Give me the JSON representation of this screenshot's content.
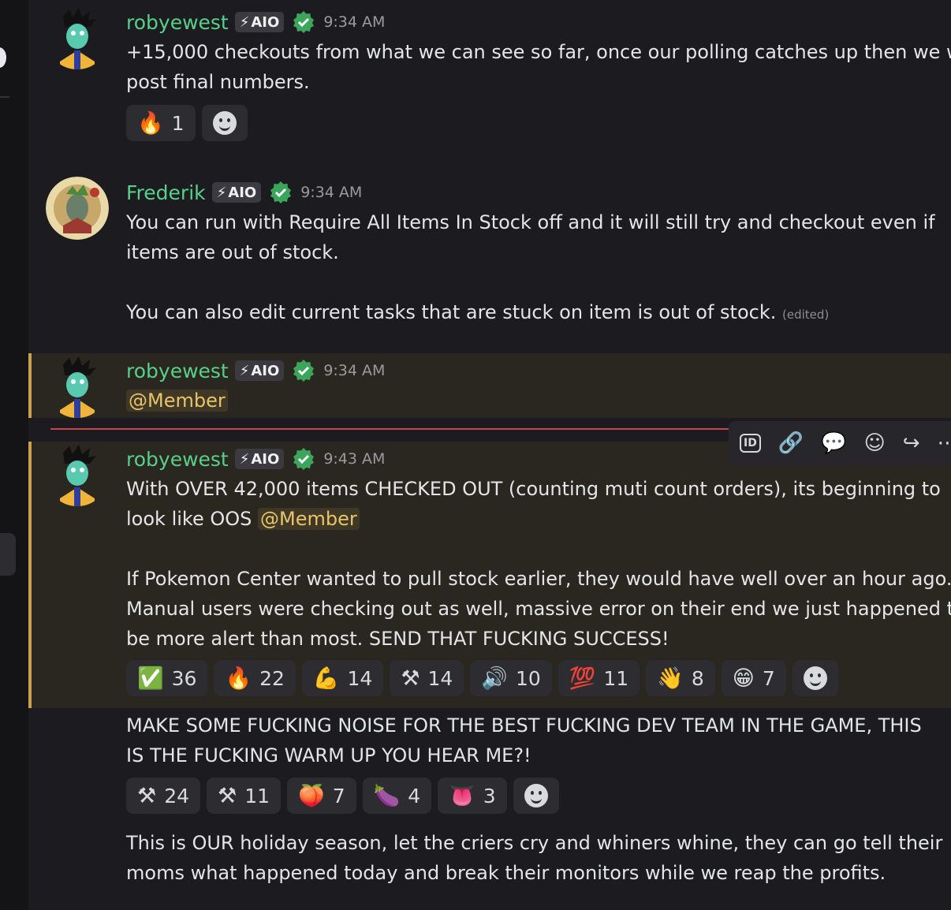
{
  "messages": [
    {
      "username": "robyewest",
      "tag": "AIO",
      "time": "9:34 AM",
      "lines": [
        "+15,000 checkouts from what we can see so far, once our polling catches up then we will",
        "post final numbers."
      ],
      "reactions": [
        {
          "emoji": "🔥",
          "count": "1"
        }
      ]
    },
    {
      "username": "Frederik",
      "tag": "AIO",
      "time": "9:34 AM",
      "lines": [
        "You can run with Require All Items In Stock off and it will still try and checkout even if",
        "items are out of stock.",
        "You can also edit current tasks that are stuck on item is out of stock."
      ],
      "edited": "(edited)"
    },
    {
      "username": "robyewest",
      "tag": "AIO",
      "time": "9:34 AM",
      "mention": "@Member"
    },
    {
      "username": "robyewest",
      "tag": "AIO",
      "time": "9:43 AM",
      "line1": "With OVER 42,000 items CHECKED OUT (counting muti count orders), its beginning to",
      "line2_prefix": "look like OOS",
      "mention": "@Member",
      "para2": [
        "If Pokemon Center wanted to pull stock earlier, they would have well over an hour ago.",
        "Manual users were checking out as well, massive error on their end we just happened to",
        "be more alert than most. SEND THAT FUCKING SUCCESS!"
      ],
      "reactions": [
        {
          "emoji": "✅",
          "count": "36"
        },
        {
          "emoji": "🔥",
          "count": "22"
        },
        {
          "emoji": "💪",
          "count": "14"
        },
        {
          "emoji": "⚒",
          "count": "14"
        },
        {
          "emoji": "🔊",
          "count": "10"
        },
        {
          "emoji": "💯",
          "count": "11"
        },
        {
          "emoji": "👋",
          "count": "8"
        },
        {
          "emoji": "😁",
          "count": "7"
        }
      ],
      "para3": [
        "MAKE SOME FUCKING NOISE FOR THE BEST FUCKING DEV TEAM IN THE GAME, THIS",
        "IS THE FUCKING WARM UP YOU HEAR ME?!"
      ],
      "reactions2": [
        {
          "emoji": "⚒",
          "count": "24"
        },
        {
          "emoji": "⚒",
          "count": "11"
        },
        {
          "emoji": "🍑",
          "count": "7"
        },
        {
          "emoji": "🍆",
          "count": "4"
        },
        {
          "emoji": "👅",
          "count": "3"
        }
      ],
      "para4": [
        "This is OUR holiday season, let the criers cry and whiners whine, they can go tell their",
        "moms what happened today and break their monitors while we reap the profits."
      ]
    }
  ],
  "toolbar": {
    "id_label": "ID",
    "icons": [
      "id-icon",
      "link-icon",
      "thread-icon",
      "add-reaction-icon",
      "forward-icon",
      "more-icon"
    ]
  },
  "colors": {
    "username": "#58d08a",
    "mention_bg": "#3f3826",
    "mention_fg": "#e8c46a",
    "highlight_bar": "#c9a24a",
    "new_divider": "#c9434a"
  }
}
